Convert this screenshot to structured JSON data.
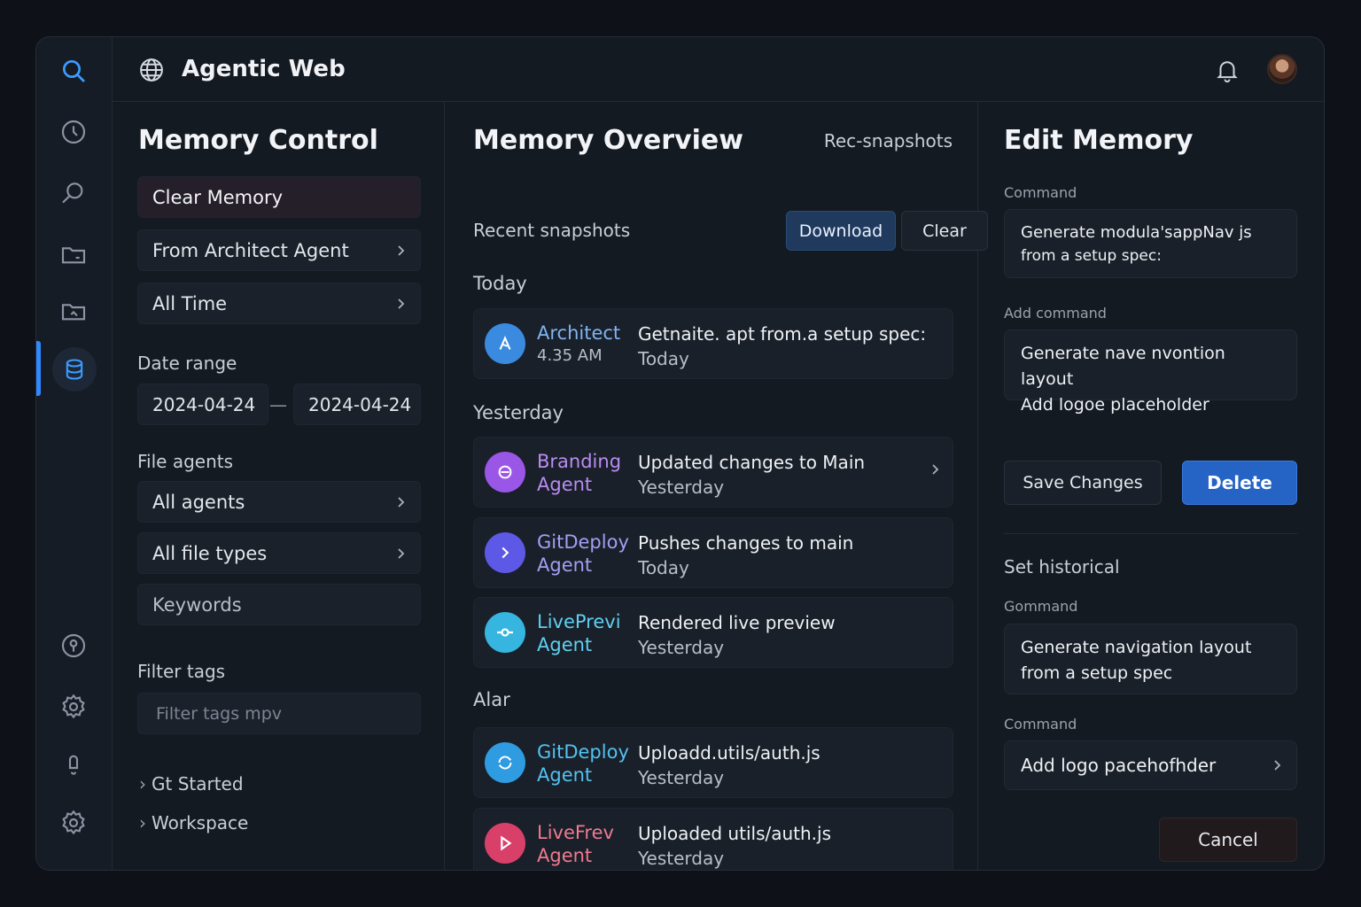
{
  "app": {
    "title": "Agentic Web"
  },
  "rail": {
    "icons": [
      "search-icon",
      "history-icon",
      "explore-icon",
      "folder-icon",
      "media-folder-icon",
      "database-icon",
      "help-icon",
      "settings-icon",
      "notification-icon",
      "gear-icon"
    ]
  },
  "left": {
    "title": "Memory Control",
    "clear_memory": "Clear Memory",
    "source": "From Architect Agent",
    "time": "All Time",
    "date_range_label": "Date range",
    "date_from": "2024-04-24",
    "date_sep": "—",
    "date_to": "2024-04-24",
    "file_agents_label": "File agents",
    "agents": "All agents",
    "file_types": "All file types",
    "keywords": "Keywords",
    "filter_tags_label": "Filter tags",
    "filter_tags_placeholder": "Filter tags mpv",
    "tree": [
      "Gt Started",
      "Workspace"
    ]
  },
  "mid": {
    "title": "Memory Overview",
    "rec_link": "Rec-snapshots",
    "subtitle": "Recent snapshots",
    "download": "Download",
    "clear": "Clear",
    "groups": [
      {
        "title": "Today"
      },
      {
        "title": "Yesterday"
      },
      {
        "title": "Alar"
      }
    ],
    "snapshots": [
      {
        "agent": "Architect",
        "sub": "4.35 AM",
        "desc": "Getnaite. apt from.a setup spec:",
        "when": "Today",
        "color": "#3a8be0",
        "agent_color": "#7fb4f0"
      },
      {
        "agent": "Branding",
        "sub": "Agent",
        "desc": "Updated changes to Main",
        "when": "Yesterday",
        "color": "#9a56e6",
        "agent_color": "#b98cf2"
      },
      {
        "agent": "GitDeploy",
        "sub": "Agent",
        "desc": "Pushes changes to main",
        "when": "Today",
        "color": "#5d58e6",
        "agent_color": "#a39ff2"
      },
      {
        "agent": "LivePrevi",
        "sub": "Agent",
        "desc": "Rendered live preview",
        "when": "Yesterday",
        "color": "#35b5e0",
        "agent_color": "#5fd0f0"
      },
      {
        "agent": "GitDeploy",
        "sub": "Agent",
        "desc": "Uploadd.utils/auth.js",
        "when": "Yesterday",
        "color": "#2f9be0",
        "agent_color": "#52c2f0"
      },
      {
        "agent": "LiveFrev",
        "sub": "Agent",
        "desc": "Uploaded utils/auth.js",
        "when": "Yesterday",
        "color": "#d8406a",
        "agent_color": "#f07a8e"
      }
    ]
  },
  "right": {
    "title": "Edit Memory",
    "command_label": "Command",
    "command_line1": "Generate modula'sappNav js",
    "command_line2": "from a setup spec:",
    "add_command_label": "Add command",
    "add_line1": "Generate nave nvontion layout",
    "add_line2": "Add logoe placeholder",
    "save": "Save Changes",
    "delete": "Delete",
    "historical_title": "Set  historical",
    "gommand_label": "Gommand",
    "hist_line1": "Generate navigation layout",
    "hist_line2": "from a setup spec",
    "command2_label": "Command",
    "command2_value": "Add logo pacehofhder",
    "cancel": "Cancel"
  },
  "colors": {
    "accent": "#2f88ff",
    "delete": "#2563c5"
  }
}
